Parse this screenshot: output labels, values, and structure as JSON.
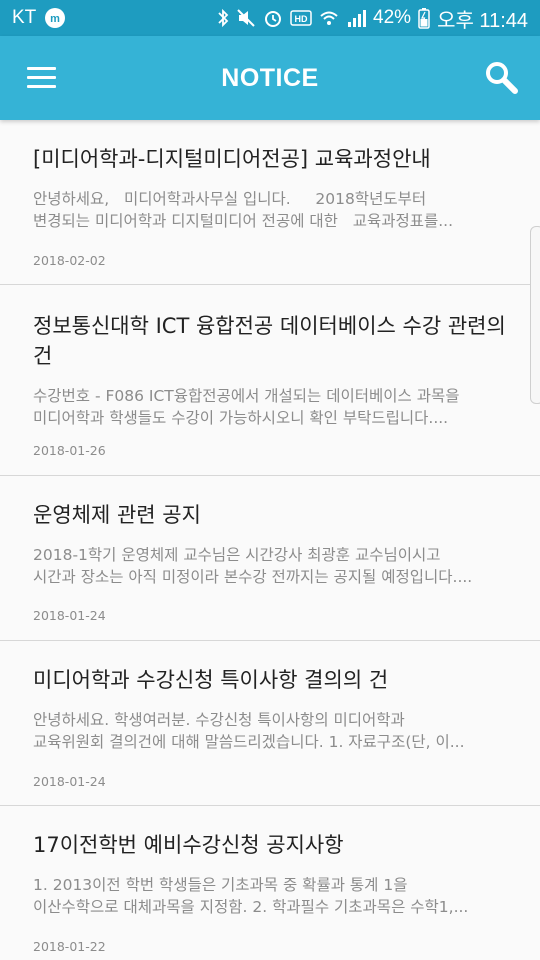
{
  "status_bar": {
    "carrier": "KT",
    "battery": "42%",
    "time": "오후 11:44"
  },
  "app_bar": {
    "title": "NOTICE",
    "menu_icon": "hamburger-menu-icon",
    "search_icon": "search-icon"
  },
  "colors": {
    "status_bar": "#1e9cc0",
    "app_bar": "#35b3d6",
    "background": "#f5f5f5"
  },
  "notices": [
    {
      "title": "[미디어학과-디지털미디어전공] 교육과정안내",
      "summary_line1": "안녕하세요,   미디어학과사무실 입니다.     2018학년도부터",
      "summary_line2": "변경되는 미디어학과 디지털미디어 전공에 대한   교육과정표를...",
      "date": "2018-02-02"
    },
    {
      "title": "정보통신대학 ICT 융합전공 데이터베이스 수강 관련의 건",
      "summary_line1": "수강번호 - F086 ICT융합전공에서 개설되는 데이터베이스 과목을",
      "summary_line2": "미디어학과 학생들도 수강이 가능하시오니 확인 부탁드립니다....",
      "date": "2018-01-26"
    },
    {
      "title": "운영체제 관련 공지",
      "summary_line1": "2018-1학기 운영체제 교수님은 시간강사 최광훈 교수님이시고",
      "summary_line2": "시간과 장소는 아직 미정이라 본수강 전까지는 공지될 예정입니다....",
      "date": "2018-01-24"
    },
    {
      "title": "미디어학과 수강신청 특이사항 결의의 건",
      "summary_line1": "안녕하세요. 학생여러분. 수강신청 특이사항의 미디어학과",
      "summary_line2": "교육위원회 결의건에 대해 말씀드리겠습니다. 1. 자료구조(단, 이...",
      "date": "2018-01-24"
    },
    {
      "title": "17이전학번 예비수강신청 공지사항",
      "summary_line1": "1. 2013이전 학번 학생들은 기초과목 중 확률과 통계 1을",
      "summary_line2": "이산수학으로 대체과목을 지정함. 2. 학과필수 기초과목은 수학1,...",
      "date": "2018-01-22"
    }
  ]
}
